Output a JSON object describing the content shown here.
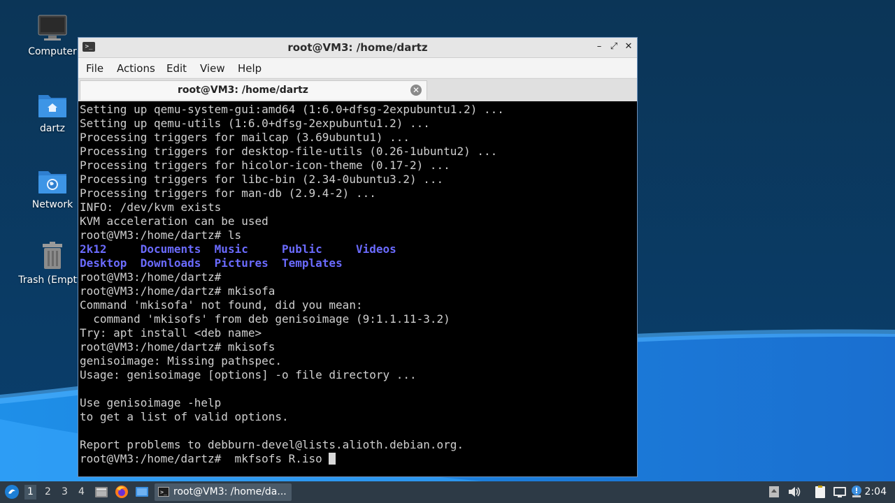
{
  "desktop": {
    "icons": [
      {
        "label": "Computer",
        "icon": "computer-icon"
      },
      {
        "label": "dartz",
        "icon": "home-folder-icon"
      },
      {
        "label": "Network",
        "icon": "network-folder-icon"
      },
      {
        "label": "Trash (Empty)",
        "icon": "trash-icon"
      }
    ]
  },
  "window": {
    "title": "root@VM3: /home/dartz",
    "menu": [
      "File",
      "Actions",
      "Edit",
      "View",
      "Help"
    ],
    "tab_title": "root@VM3: /home/dartz"
  },
  "terminal": {
    "lines": [
      "Setting up qemu-system-gui:amd64 (1:6.0+dfsg-2expubuntu1.2) ...",
      "Setting up qemu-utils (1:6.0+dfsg-2expubuntu1.2) ...",
      "Processing triggers for mailcap (3.69ubuntu1) ...",
      "Processing triggers for desktop-file-utils (0.26-1ubuntu2) ...",
      "Processing triggers for hicolor-icon-theme (0.17-2) ...",
      "Processing triggers for libc-bin (2.34-0ubuntu3.2) ...",
      "Processing triggers for man-db (2.9.4-2) ...",
      "INFO: /dev/kvm exists",
      "KVM acceleration can be used",
      "root@VM3:/home/dartz# ls"
    ],
    "ls_row1": [
      "2k12",
      "Documents",
      "Music",
      "Public",
      "Videos"
    ],
    "ls_row2": [
      "Desktop",
      "Downloads",
      "Pictures",
      "Templates"
    ],
    "lines_after": [
      "root@VM3:/home/dartz#",
      "root@VM3:/home/dartz# mkisofa",
      "Command 'mkisofa' not found, did you mean:",
      "  command 'mkisofs' from deb genisoimage (9:1.1.11-3.2)",
      "Try: apt install <deb name>",
      "root@VM3:/home/dartz# mkisofs",
      "genisoimage: Missing pathspec.",
      "Usage: genisoimage [options] -o file directory ...",
      "",
      "Use genisoimage -help",
      "to get a list of valid options.",
      "",
      "Report problems to debburn-devel@lists.alioth.debian.org."
    ],
    "prompt": "root@VM3:/home/dartz#  mkfsofs R.iso "
  },
  "taskbar": {
    "workspaces": [
      "1",
      "2",
      "3",
      "4"
    ],
    "active_workspace": "1",
    "task_label": "root@VM3: /home/da...",
    "clock": "2:04"
  },
  "colors": {
    "terminal_bg": "#000000",
    "terminal_fg": "#d0d0d0",
    "directory": "#6b6bff",
    "taskbar_bg": "#2d3a46"
  }
}
